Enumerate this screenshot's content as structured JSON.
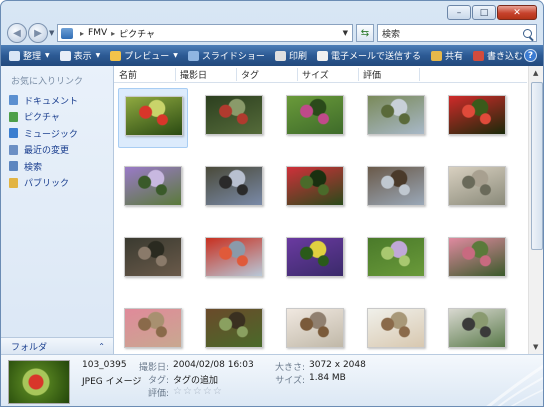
{
  "address": {
    "crumbs": [
      "FMV",
      "ピクチャ"
    ]
  },
  "search": {
    "placeholder": "検索"
  },
  "toolbar": {
    "items": [
      {
        "label": "整理",
        "icon": "organize-icon",
        "dropdown": true,
        "color": "#d9e6f6"
      },
      {
        "label": "表示",
        "icon": "views-icon",
        "dropdown": true,
        "color": "#e8eef7"
      },
      {
        "label": "プレビュー",
        "icon": "preview-icon",
        "dropdown": true,
        "color": "#f3c34a"
      },
      {
        "label": "スライドショー",
        "icon": "slideshow-icon",
        "dropdown": false,
        "color": "#8fb5e2"
      },
      {
        "label": "印刷",
        "icon": "print-icon",
        "dropdown": false,
        "color": "#e0e0e0"
      },
      {
        "label": "電子メールで送信する",
        "icon": "email-icon",
        "dropdown": false,
        "color": "#f0f0f0"
      },
      {
        "label": "共有",
        "icon": "share-icon",
        "dropdown": false,
        "color": "#e6b84a"
      },
      {
        "label": "書き込む",
        "icon": "burn-icon",
        "dropdown": false,
        "color": "#d24b3c"
      }
    ],
    "help_label": "?"
  },
  "sidebar": {
    "title": "お気に入りリンク",
    "items": [
      {
        "label": "ドキュメント",
        "icon": "documents-icon",
        "color": "#5b8fd0"
      },
      {
        "label": "ピクチャ",
        "icon": "pictures-icon",
        "color": "#4e9f4a"
      },
      {
        "label": "ミュージック",
        "icon": "music-icon",
        "color": "#3b7ed0"
      },
      {
        "label": "最近の変更",
        "icon": "recent-changes-icon",
        "color": "#6b8fc4"
      },
      {
        "label": "検索",
        "icon": "search-folder-icon",
        "color": "#5c86c0"
      },
      {
        "label": "パブリック",
        "icon": "public-icon",
        "color": "#e2b443"
      }
    ],
    "folder_label": "フォルダ"
  },
  "columns": [
    "名前",
    "撮影日",
    "タグ",
    "サイズ",
    "評価"
  ],
  "thumbnails": [
    {
      "name": "red-berries-photo",
      "selected": true,
      "colors": [
        "#2a4a12",
        "#8fa940",
        "#d8362a",
        "#c9d46a"
      ]
    },
    {
      "name": "red-flower-branches-photo",
      "colors": [
        "#556b3a",
        "#2c3f1f",
        "#b03a2e",
        "#8a9a6a"
      ]
    },
    {
      "name": "green-plant-pink-flower-photo",
      "colors": [
        "#3e6b2a",
        "#6a9a3a",
        "#c04a8a",
        "#2a4a1a"
      ]
    },
    {
      "name": "tree-sky-photo",
      "colors": [
        "#a8b8c8",
        "#7a8a5a",
        "#5a6a3a",
        "#c8d0d8"
      ]
    },
    {
      "name": "red-dahlias-photo",
      "colors": [
        "#1a2a0a",
        "#d02a2a",
        "#e04a3a",
        "#3a5a1a"
      ]
    },
    {
      "name": "purple-wildflowers-photo",
      "colors": [
        "#5a7a3a",
        "#9a7ac8",
        "#3a5a2a",
        "#c8b8e0"
      ]
    },
    {
      "name": "mountain-photo",
      "colors": [
        "#7a8aa8",
        "#4a4a3a",
        "#2a2a2a",
        "#b8c0d0"
      ]
    },
    {
      "name": "red-camellia-photo",
      "colors": [
        "#2a4a1a",
        "#d0303a",
        "#4a6a2a",
        "#1a3010"
      ]
    },
    {
      "name": "bare-tree-sky-photo",
      "colors": [
        "#9aa8b8",
        "#6a5a4a",
        "#c0c8d0",
        "#4a3a2a"
      ]
    },
    {
      "name": "pampas-grass-photo",
      "colors": [
        "#8a8a7a",
        "#d8d0c0",
        "#6a6a5a",
        "#a8a090"
      ]
    },
    {
      "name": "rock-stream-photo",
      "colors": [
        "#6a5a4a",
        "#3a3a30",
        "#8a7a6a",
        "#2a2a20"
      ]
    },
    {
      "name": "red-maple-branches-photo",
      "colors": [
        "#b8c8d8",
        "#c83020",
        "#e05a3a",
        "#8a9aaa"
      ]
    },
    {
      "name": "purple-pansies-photo",
      "colors": [
        "#3a2a6a",
        "#6a3aa0",
        "#2a5a1a",
        "#e0d040"
      ]
    },
    {
      "name": "small-flower-green-photo",
      "colors": [
        "#6a9a3a",
        "#4a7a2a",
        "#a8c870",
        "#c0a8d8"
      ]
    },
    {
      "name": "pink-blossom-cluster-photo",
      "colors": [
        "#3a5a2a",
        "#e08aa0",
        "#c86a80",
        "#5a7a3a"
      ]
    },
    {
      "name": "pink-buds-photo",
      "colors": [
        "#c8a890",
        "#e08a9a",
        "#8a6a4a",
        "#a89070"
      ]
    },
    {
      "name": "pine-cone-photo",
      "colors": [
        "#4a6a2a",
        "#6a4a2a",
        "#8aa060",
        "#3a3020"
      ]
    },
    {
      "name": "kitten-photo",
      "colors": [
        "#c0b8a8",
        "#f0e8e0",
        "#7a5a3a",
        "#908070"
      ]
    },
    {
      "name": "two-kittens-photo",
      "colors": [
        "#d8c8b0",
        "#f0f0ea",
        "#8a6a4a",
        "#a89878"
      ]
    },
    {
      "name": "cat-grass-photo",
      "colors": [
        "#5a7a4a",
        "#d8d8d0",
        "#3a3a3a",
        "#8a9a70"
      ]
    }
  ],
  "details": {
    "file_name": "103_0395",
    "file_type": "JPEG イメージ",
    "date_taken_label": "撮影日:",
    "date_taken": "2004/02/08 16:03",
    "tags_label": "タグ:",
    "tags": "タグの追加",
    "rating_label": "評価:",
    "rating_stars": "☆☆☆☆☆",
    "dimensions_label": "大きさ:",
    "dimensions": "3072 x 2048",
    "size_label": "サイズ:",
    "size": "1.84 MB"
  }
}
